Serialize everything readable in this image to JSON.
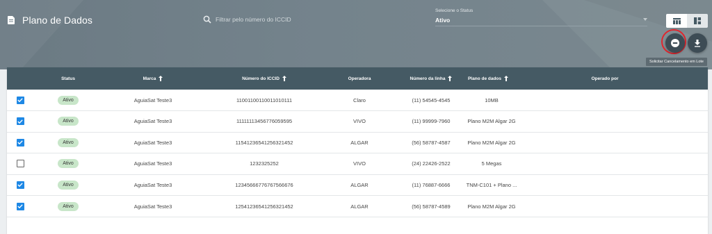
{
  "header": {
    "title": "Plano de Dados",
    "search_placeholder": "Filtrar pelo número do ICCID",
    "status_label": "Selecione o Status",
    "status_value": "Ativo",
    "view_toggle": [
      "table-icon",
      "grid-icon"
    ],
    "tooltip": "Solicitar Cancelamento em Lote",
    "accent_highlight": "#e0262e"
  },
  "table": {
    "header_bg": "#455a64",
    "columns": [
      "Status",
      "Marca",
      "Número do ICCID",
      "Operadora",
      "Número da linha",
      "Plano de dados",
      "Operado por"
    ],
    "rows": [
      {
        "checked": true,
        "status": "Ativo",
        "marca": "AguiaSat Teste3",
        "iccid": "11001100110011010111",
        "operadora": "Claro",
        "linha": "(11) 54545-4545",
        "plano": "10MB",
        "operado": ""
      },
      {
        "checked": true,
        "status": "Ativo",
        "marca": "AguiaSat Teste3",
        "iccid": "11111113456776059595",
        "operadora": "VIVO",
        "linha": "(11) 99999-7960",
        "plano": "Plano M2M Algar 2G",
        "operado": ""
      },
      {
        "checked": true,
        "status": "Ativo",
        "marca": "AguiaSat Teste3",
        "iccid": "11541236541256321452",
        "operadora": "ALGAR",
        "linha": "(56) 58787-4587",
        "plano": "Plano M2M Algar 2G",
        "operado": ""
      },
      {
        "checked": false,
        "status": "Ativo",
        "marca": "AguiaSat Teste3",
        "iccid": "1232325252",
        "operadora": "VIVO",
        "linha": "(24) 22426-2522",
        "plano": "5 Megas",
        "operado": ""
      },
      {
        "checked": true,
        "status": "Ativo",
        "marca": "AguiaSat Teste3",
        "iccid": "12345666776767566676",
        "operadora": "ALGAR",
        "linha": "(11) 76887-6666",
        "plano": "TNM-C101 + Plano ...",
        "operado": ""
      },
      {
        "checked": true,
        "status": "Ativo",
        "marca": "AguiaSat Teste3",
        "iccid": "12541236541256321452",
        "operadora": "ALGAR",
        "linha": "(56) 58787-4589",
        "plano": "Plano M2M Algar 2G",
        "operado": ""
      }
    ]
  }
}
